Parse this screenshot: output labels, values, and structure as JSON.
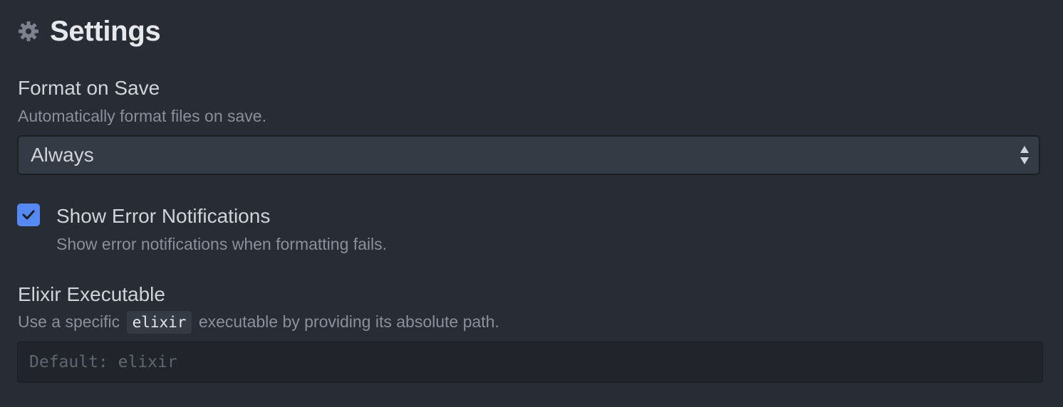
{
  "header": {
    "icon": "gear-icon",
    "title": "Settings"
  },
  "settings": {
    "format_on_save": {
      "title": "Format on Save",
      "description": "Automatically format files on save.",
      "selected": "Always"
    },
    "show_error_notifications": {
      "title": "Show Error Notifications",
      "description": "Show error notifications when formatting fails.",
      "checked": true
    },
    "elixir_executable": {
      "title": "Elixir Executable",
      "description_prefix": "Use a specific",
      "description_code": "elixir",
      "description_suffix": "executable by providing its absolute path.",
      "placeholder": "Default: elixir",
      "value": ""
    }
  },
  "colors": {
    "background": "#282c34",
    "accent": "#568af2",
    "input_background": "#21252b",
    "select_background": "#353b45"
  }
}
